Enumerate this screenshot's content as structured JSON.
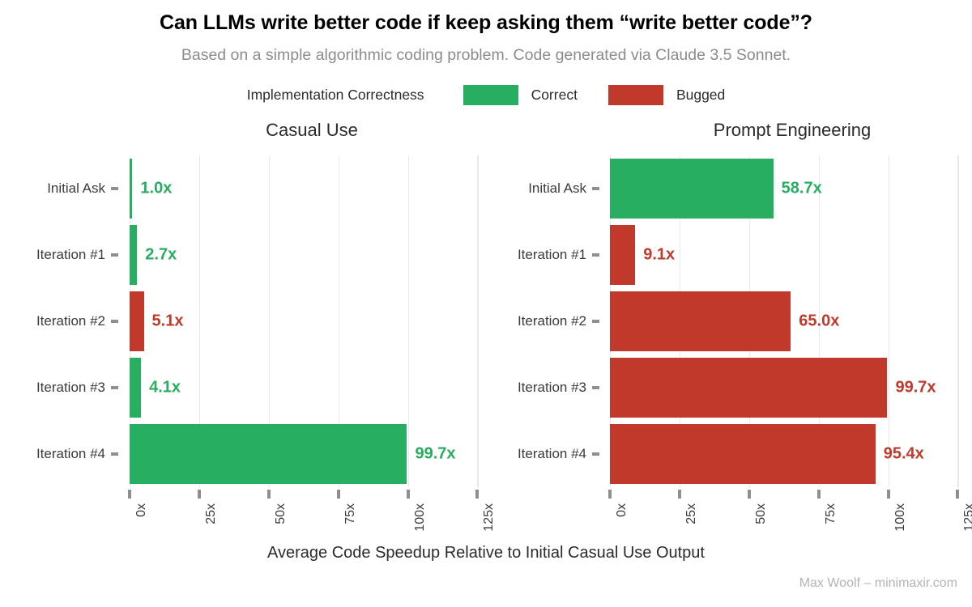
{
  "chart_data": {
    "type": "bar",
    "orientation": "horizontal",
    "title": "Can LLMs write better code if keep asking them “write better code”?",
    "subtitle": "Based on a simple algorithmic coding problem. Code generated via Claude 3.5 Sonnet.",
    "xlabel": "Average Code Speedup Relative to Initial Casual Use Output",
    "ylabel": "",
    "caption": "Max Woolf – minimaxir.com",
    "grid": true,
    "legend_position": "top",
    "legend": {
      "title": "Implementation Correctness",
      "entries": [
        {
          "label": "Correct",
          "color": "#27ae60"
        },
        {
          "label": "Bugged",
          "color": "#c0392b"
        }
      ]
    },
    "xlim": [
      0,
      131
    ],
    "xticks": [
      0,
      25,
      50,
      75,
      100,
      125
    ],
    "xtick_labels": [
      "0x",
      "25x",
      "50x",
      "75x",
      "100x",
      "125x"
    ],
    "categories": [
      "Initial Ask",
      "Iteration #1",
      "Iteration #2",
      "Iteration #3",
      "Iteration #4"
    ],
    "facets": [
      {
        "name": "Casual Use",
        "bars": [
          {
            "category": "Initial Ask",
            "value": 1.0,
            "label": "1.0x",
            "status": "Correct",
            "color": "#27ae60"
          },
          {
            "category": "Iteration #1",
            "value": 2.7,
            "label": "2.7x",
            "status": "Correct",
            "color": "#27ae60"
          },
          {
            "category": "Iteration #2",
            "value": 5.1,
            "label": "5.1x",
            "status": "Bugged",
            "color": "#c0392b"
          },
          {
            "category": "Iteration #3",
            "value": 4.1,
            "label": "4.1x",
            "status": "Correct",
            "color": "#27ae60"
          },
          {
            "category": "Iteration #4",
            "value": 99.7,
            "label": "99.7x",
            "status": "Correct",
            "color": "#27ae60"
          }
        ]
      },
      {
        "name": "Prompt Engineering",
        "bars": [
          {
            "category": "Initial Ask",
            "value": 58.7,
            "label": "58.7x",
            "status": "Correct",
            "color": "#27ae60"
          },
          {
            "category": "Iteration #1",
            "value": 9.1,
            "label": "9.1x",
            "status": "Bugged",
            "color": "#c0392b"
          },
          {
            "category": "Iteration #2",
            "value": 65.0,
            "label": "65.0x",
            "status": "Bugged",
            "color": "#c0392b"
          },
          {
            "category": "Iteration #3",
            "value": 99.7,
            "label": "99.7x",
            "status": "Bugged",
            "color": "#c0392b"
          },
          {
            "category": "Iteration #4",
            "value": 95.4,
            "label": "95.4x",
            "status": "Bugged",
            "color": "#c0392b"
          }
        ]
      }
    ]
  }
}
